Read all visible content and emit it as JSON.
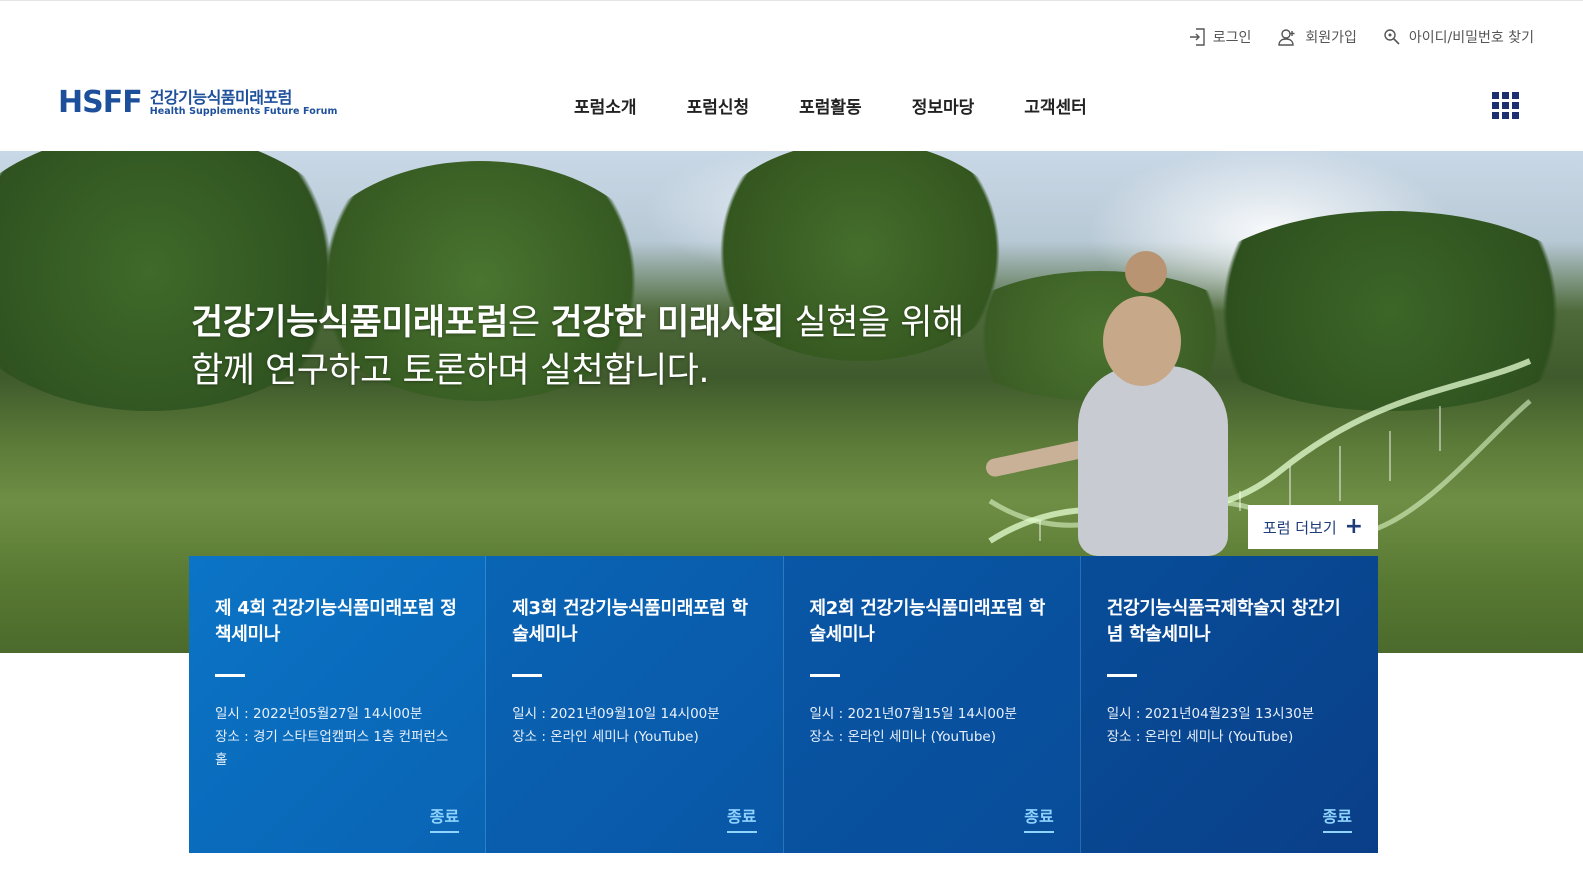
{
  "util": {
    "login": "로그인",
    "join": "회원가입",
    "find": "아이디/비밀번호 찾기"
  },
  "logo": {
    "mark": "HSFF",
    "name_ko": "건강기능식품미래포럼",
    "name_en": "Health Supplements Future Forum"
  },
  "gnb": [
    "포럼소개",
    "포럼신청",
    "포럼활동",
    "정보마당",
    "고객센터"
  ],
  "hero": {
    "line1_bold_a": "건강기능식품미래포럼",
    "line1_normal_a": "은 ",
    "line1_bold_b": "건강한 미래사회",
    "line1_normal_b": " 실현을 위해",
    "line2": "함께 연구하고 토론하며 실천합니다.",
    "more_label": "포럼 더보기"
  },
  "cards": [
    {
      "title": "제 4회 건강기능식품미래포럼 정책세미나",
      "date": "일시 : 2022년05월27일 14시00분",
      "place": "장소 : 경기 스타트업캠퍼스 1층 컨퍼런스홀",
      "status": "종료",
      "color_from": "#0b74c6",
      "color_to": "#0a63b3"
    },
    {
      "title": "제3회 건강기능식품미래포럼 학술세미나",
      "date": "일시 : 2021년09월10일 14시00분",
      "place": "장소 : 온라인 세미나 (YouTube)",
      "status": "종료",
      "color_from": "#0a64b4",
      "color_to": "#0956a6"
    },
    {
      "title": "제2회 건강기능식품미래포럼 학술세미나",
      "date": "일시 : 2021년07월15일 14시00분",
      "place": "장소 : 온라인 세미나 (YouTube)",
      "status": "종료",
      "color_from": "#0957a6",
      "color_to": "#084c99"
    },
    {
      "title": "건강기능식품국제학술지 창간기념 학술세미나",
      "date": "일시 : 2021년04월23일 13시30분",
      "place": "장소 : 온라인 세미나 (YouTube)",
      "status": "종료",
      "color_from": "#084d99",
      "color_to": "#0a3f88"
    }
  ]
}
